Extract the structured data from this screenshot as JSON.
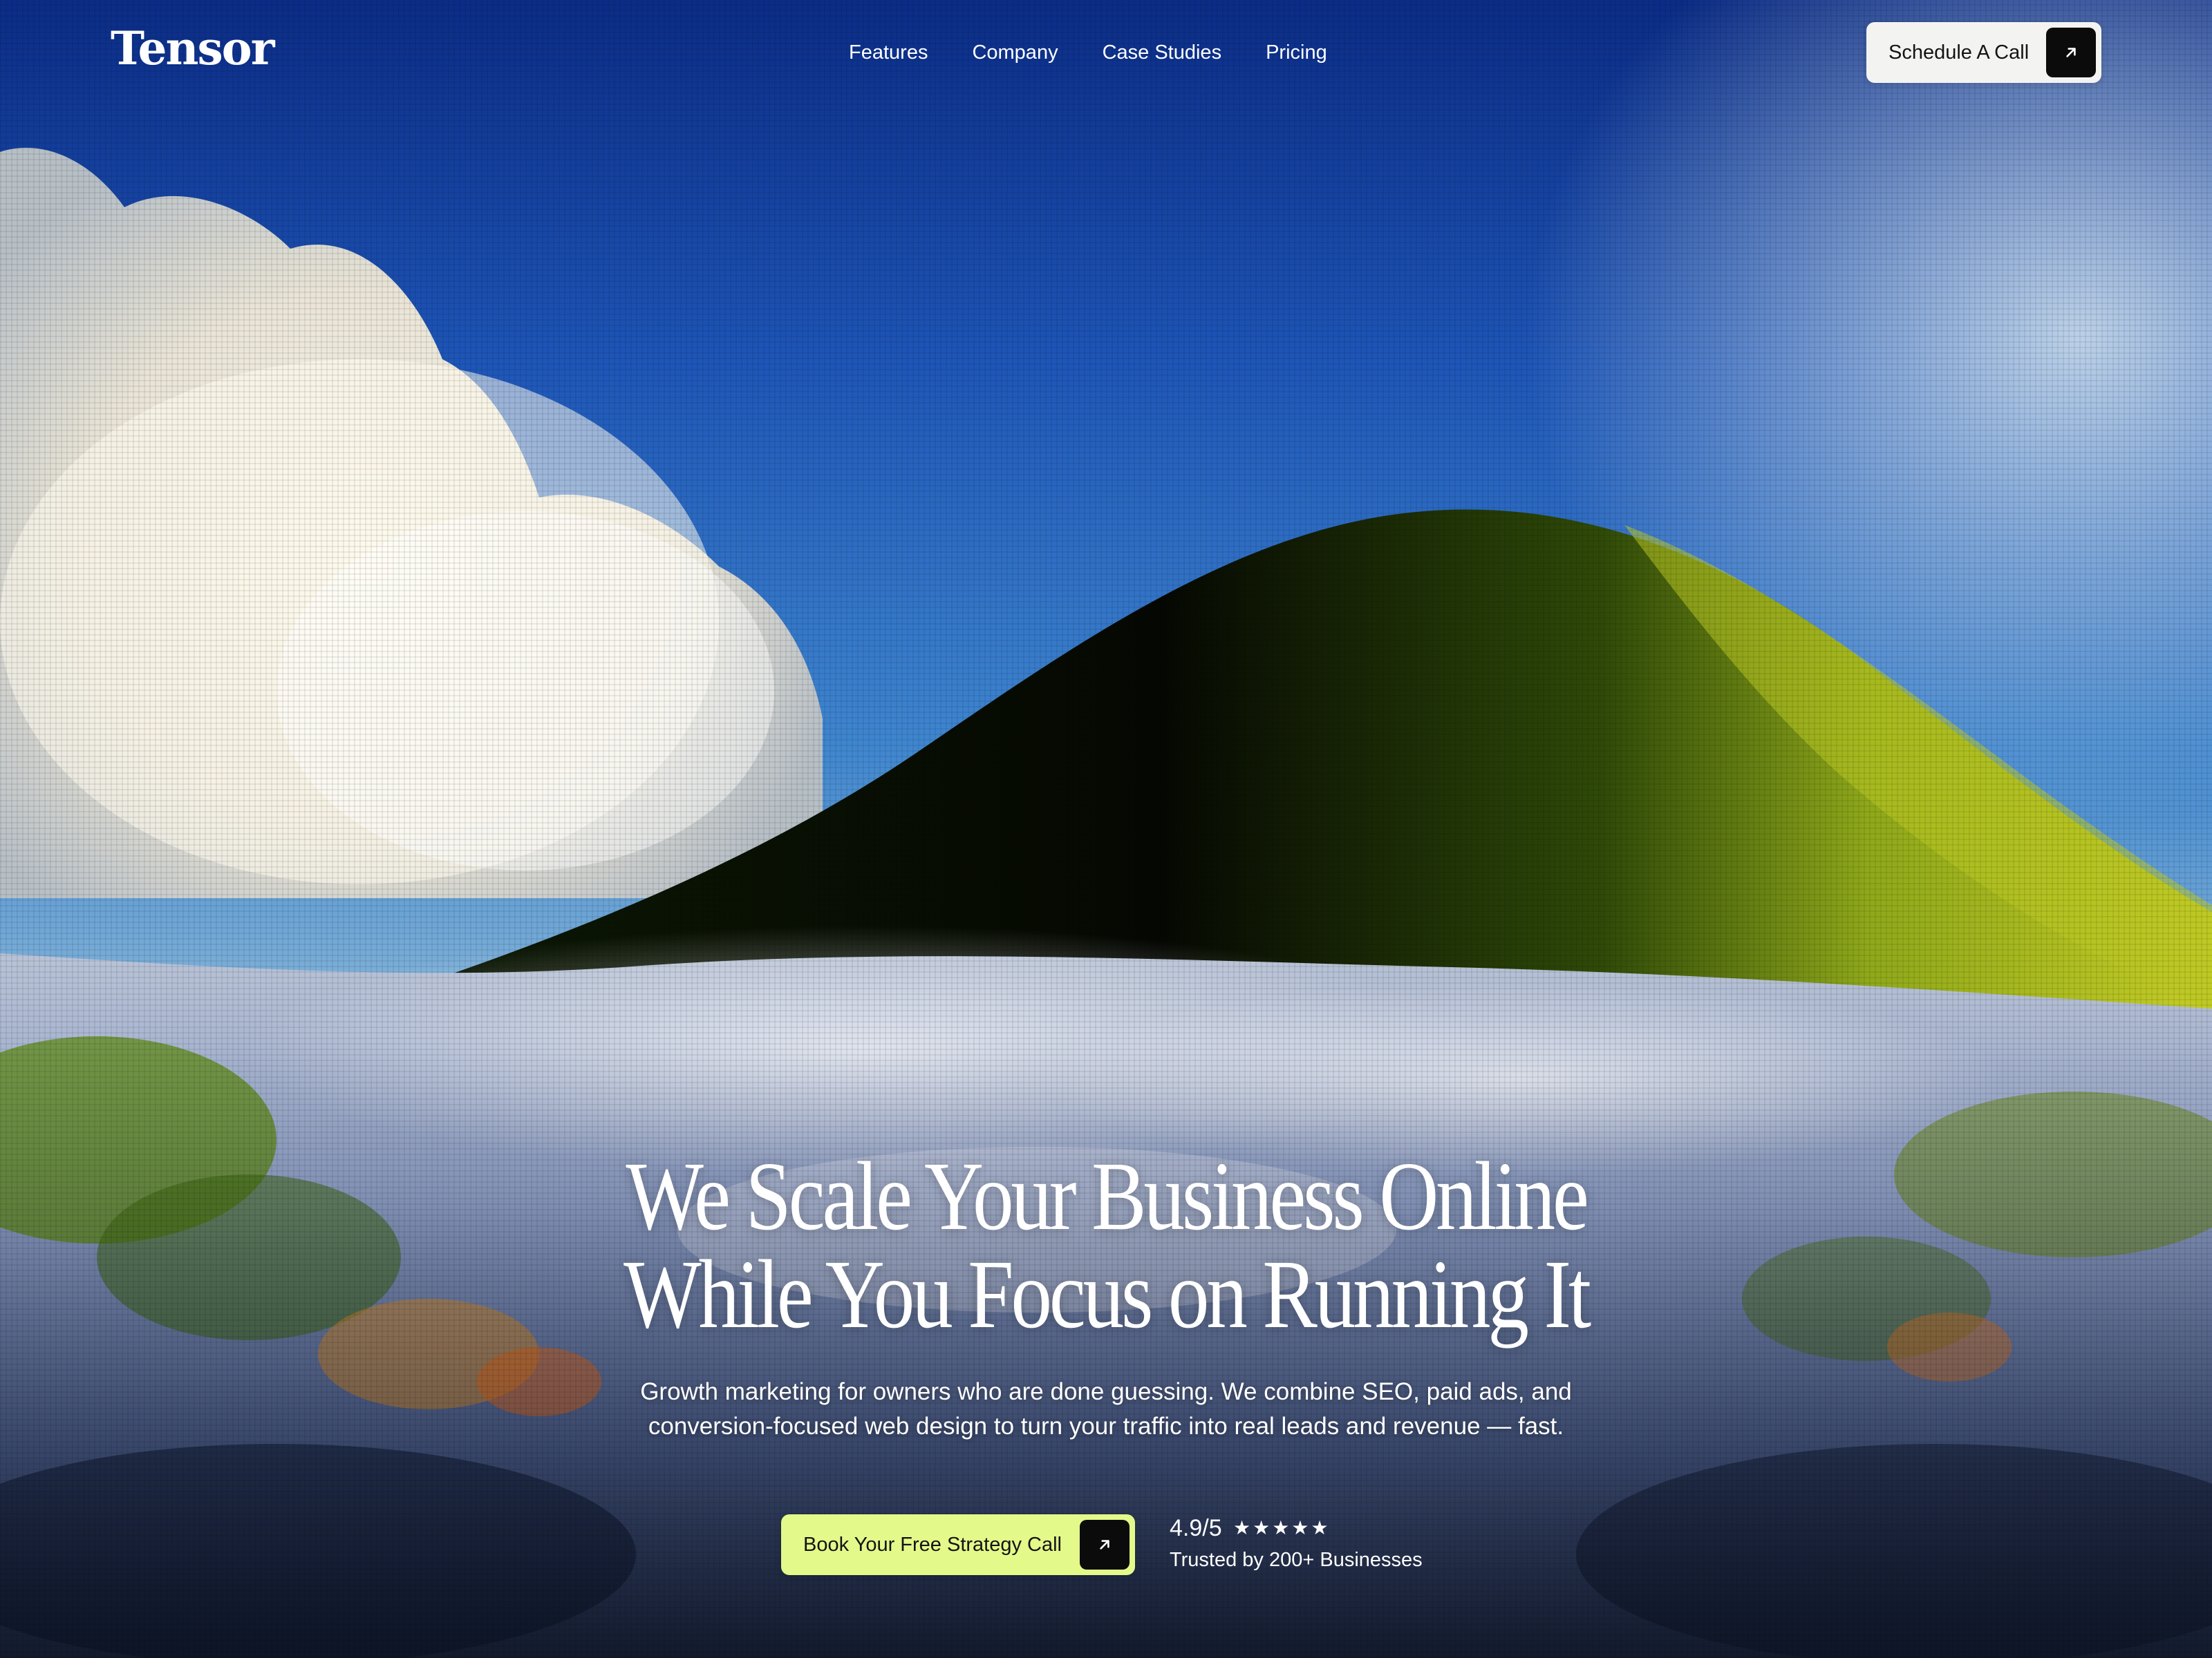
{
  "brand": {
    "name": "Tensor"
  },
  "nav": {
    "links": [
      "Features",
      "Company",
      "Case Studies",
      "Pricing"
    ],
    "cta_label": "Schedule A Call"
  },
  "hero": {
    "title_lines": [
      "We Scale Your Business Online",
      "While You Focus on Running It"
    ],
    "subtitle": "Growth marketing for owners who are done guessing. We combine SEO, paid ads, and conversion-focused web design to turn your traffic into real leads and revenue — fast.",
    "primary_cta_label": "Book Your Free Strategy Call",
    "rating": {
      "score": "4.9/5",
      "stars": 5,
      "caption": "Trusted by 200+ Businesses"
    }
  },
  "icons": {
    "nav_cta": "arrow-up-right-icon",
    "primary_cta": "arrow-up-right-icon",
    "rating": "star-icon"
  },
  "colors": {
    "primary_cta_bg": "#e3f98a",
    "nav_cta_bg": "#f3f3f1",
    "arrow_box_bg": "#0b0b0b",
    "text_on_hero": "#ffffff"
  }
}
